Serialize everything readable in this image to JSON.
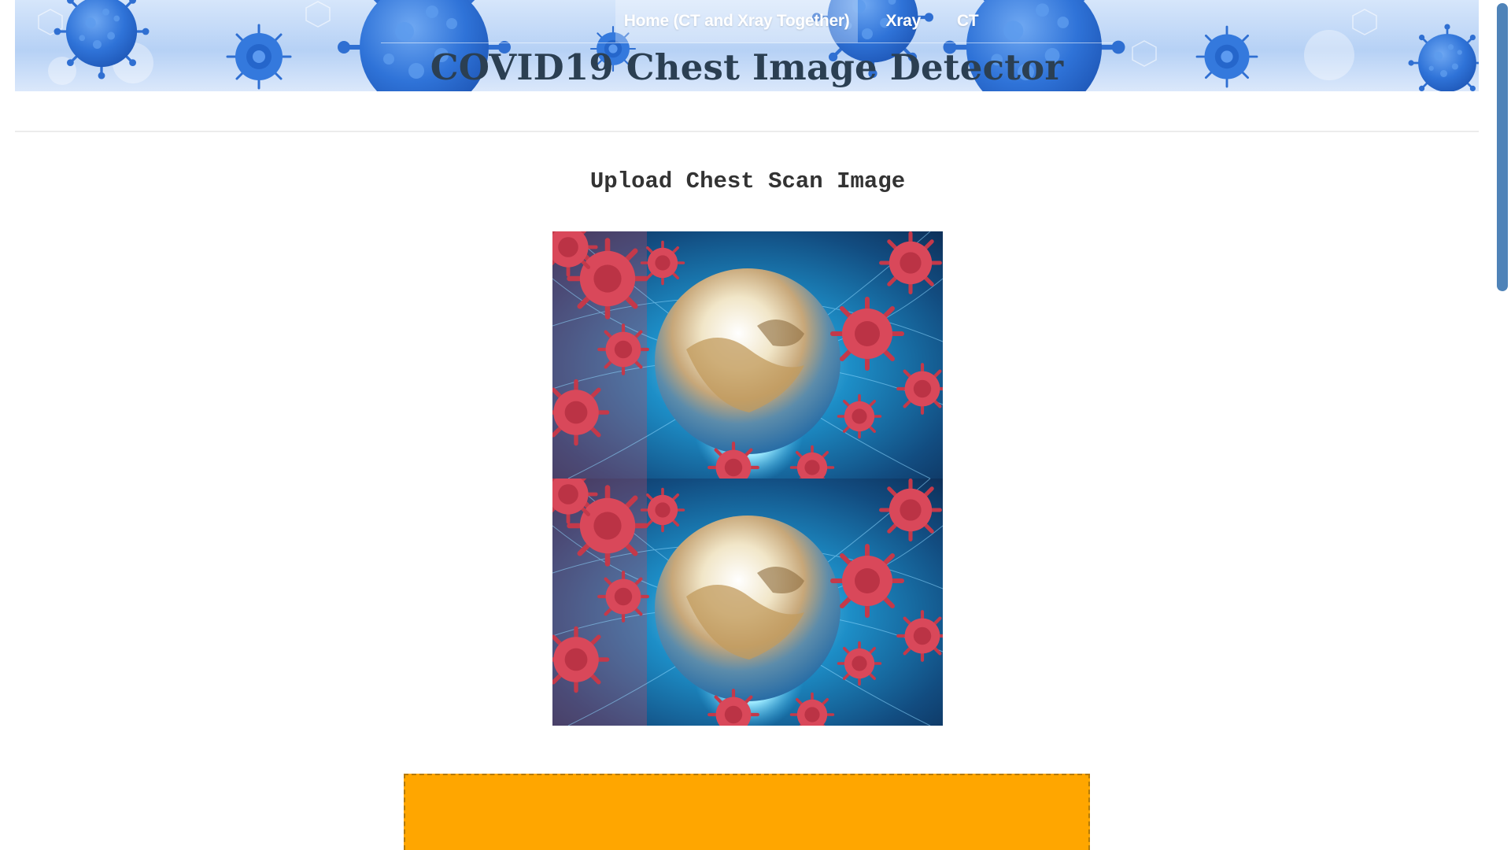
{
  "nav": {
    "items": [
      {
        "label": "Home (CT and Xray Together)",
        "active": true
      },
      {
        "label": "Xray",
        "active": false
      },
      {
        "label": "CT",
        "active": false
      }
    ]
  },
  "header": {
    "title": "COVID19 Chest Image Detector"
  },
  "main": {
    "upload_heading": "Upload Chest Scan Image",
    "preview_image": "virus-globe-illustration"
  },
  "colors": {
    "banner_blue": "#3a7fe0",
    "title_text": "#2b3f52",
    "dropzone": "#ffa600",
    "scrollbar_thumb": "#4f83b8"
  }
}
